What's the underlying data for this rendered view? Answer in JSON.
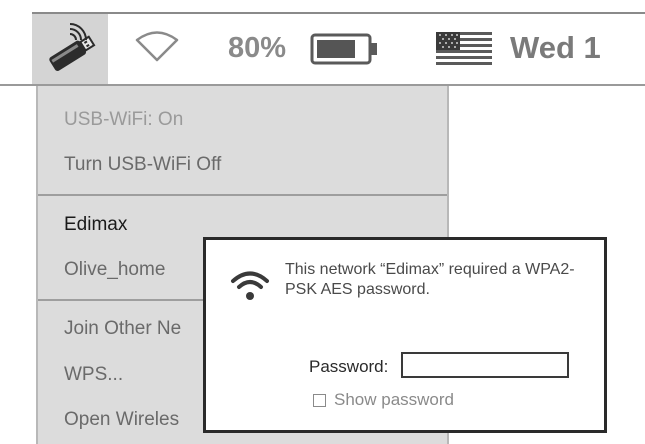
{
  "menubar": {
    "icons": {
      "usb_wifi": "usb-wifi-icon",
      "wifi": "wifi-icon",
      "battery": "battery-icon",
      "flag": "us-flag-icon"
    },
    "battery_percent": "80%",
    "battery_level": 0.8,
    "clock": "Wed 1"
  },
  "menu": {
    "status": "USB-WiFi: On",
    "toggle": "Turn USB-WiFi Off",
    "networks": [
      "Edimax",
      "Olive_home"
    ],
    "actions": [
      "Join Other Ne",
      "WPS...",
      "Open Wireles"
    ]
  },
  "dialog": {
    "message": "This network “Edimax” required a WPA2-PSK AES password.",
    "password_label": "Password:",
    "password_value": "",
    "show_password_label": "Show password",
    "show_password_checked": false
  },
  "colors": {
    "menu_bg": "#dcdcdc",
    "dialog_border": "#2a2a2a"
  }
}
